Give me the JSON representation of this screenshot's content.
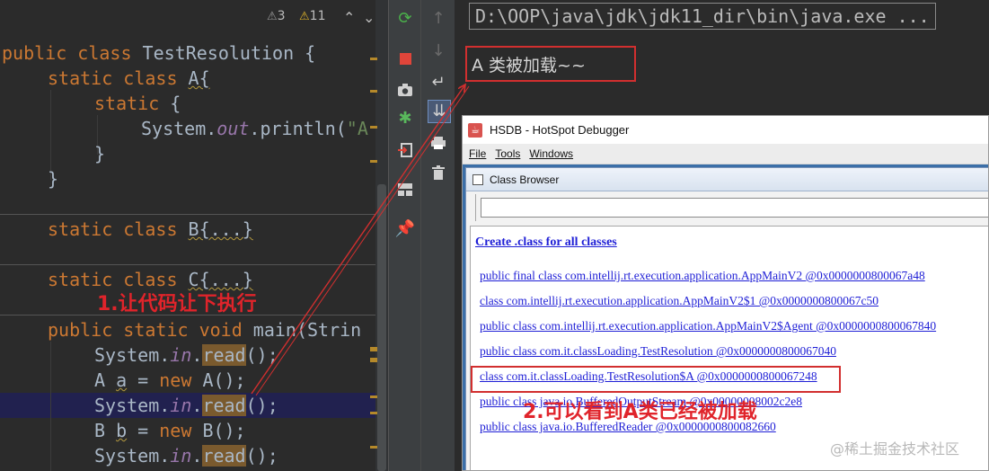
{
  "editor": {
    "header": {
      "warnings": "3",
      "weak_warnings": "11"
    },
    "lines": {
      "l1": {
        "kw": "public class ",
        "name": "TestResolution {"
      },
      "l2": {
        "kw": "static class ",
        "name": "A{"
      },
      "l3": {
        "kw": "static ",
        "rest": "{"
      },
      "l4": {
        "pre": "System.",
        "field": "out",
        "mid": ".println(",
        "str": "\"A"
      },
      "l5": {
        "text": "}"
      },
      "l6": {
        "text": "}"
      },
      "l7": {
        "kw": "static class ",
        "name": "B{...}"
      },
      "l8": {
        "kw": "static class ",
        "name": "C{...}"
      },
      "l9": {
        "kw": "public static void ",
        "name": "main(Strin"
      },
      "l10": {
        "pre": "System.",
        "field": "in",
        "dot": ".",
        "hl": "read",
        "post": "();"
      },
      "l11": {
        "pre": "A ",
        "var": "a",
        "eq": " = ",
        "kw": "new ",
        "post": "A();"
      },
      "l12": {
        "pre": "System.",
        "field": "in",
        "dot": ".",
        "hl": "read",
        "post": "();"
      },
      "l13": {
        "pre": "B ",
        "var": "b",
        "eq": " = ",
        "kw": "new ",
        "post": "B();"
      },
      "l14": {
        "pre": "System.",
        "field": "in",
        "dot": ".",
        "hl": "read",
        "post": "();"
      }
    }
  },
  "toolbar": {
    "rerun": "rerun-icon",
    "stop": "stop-icon",
    "camera": "camera-icon",
    "debug": "debug-icon",
    "exit": "exit-icon",
    "layout": "layout-icon",
    "pin": "pin-icon",
    "up": "arrow-up-icon",
    "down": "arrow-down-icon",
    "wrap": "soft-wrap-icon",
    "scroll": "scroll-to-end-icon",
    "print": "print-icon",
    "trash": "trash-icon"
  },
  "console": {
    "command": "D:\\OOP\\java\\jdk\\jdk11_dir\\bin\\java.exe ...",
    "output": "A  类被加载~~"
  },
  "hsdb": {
    "title": "HSDB - HotSpot Debugger",
    "menu": [
      "File",
      "Tools",
      "Windows"
    ],
    "class_browser": {
      "title": "Class Browser",
      "create_link": "Create .class for all classes",
      "classes": [
        "public final class com.intellij.rt.execution.application.AppMainV2 @0x0000000800067a48",
        "class com.intellij.rt.execution.application.AppMainV2$1 @0x0000000800067c50",
        "public class com.intellij.rt.execution.application.AppMainV2$Agent @0x0000000800067840",
        "public class com.it.classLoading.TestResolution @0x0000000800067040",
        "class com.it.classLoading.TestResolution$A @0x0000000800067248",
        "public class java.io.BufferedOutputStream @0x00000008002c2e8",
        "public class java.io.BufferedReader @0x0000000800082660"
      ]
    }
  },
  "annotations": {
    "step1": "1.让代码让下执行",
    "step2": "2.可以看到A类已经被加载"
  },
  "watermark": "@稀土掘金技术社区",
  "colors": {
    "annotation": "#e0242b",
    "link": "#1f1fd6",
    "current_line": "#21214f"
  }
}
